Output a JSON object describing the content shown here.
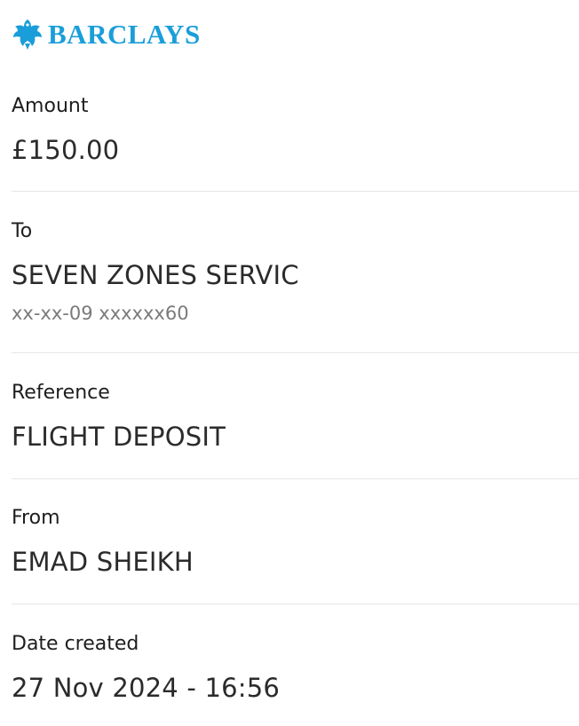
{
  "brand": {
    "name": "BARCLAYS",
    "color": "#1a9ed9",
    "icon": "eagle-icon"
  },
  "amount": {
    "label": "Amount",
    "value": "£150.00"
  },
  "to": {
    "label": "To",
    "name": "SEVEN ZONES SERVIC",
    "account": "xx-xx-09 xxxxxx60"
  },
  "reference": {
    "label": "Reference",
    "value": "FLIGHT DEPOSIT"
  },
  "from": {
    "label": "From",
    "value": "EMAD SHEIKH"
  },
  "date_created": {
    "label": "Date created",
    "value": "27 Nov 2024 - 16:56"
  }
}
